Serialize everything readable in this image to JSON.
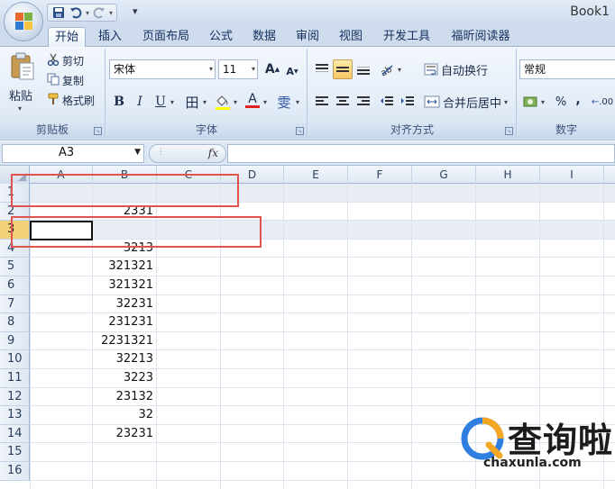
{
  "window": {
    "title": "Book1"
  },
  "quick_access": {
    "icons": [
      "save-icon",
      "undo-icon",
      "redo-icon"
    ],
    "customize_glyph": "▾"
  },
  "tabs": [
    "开始",
    "插入",
    "页面布局",
    "公式",
    "数据",
    "审阅",
    "视图",
    "开发工具",
    "福昕阅读器"
  ],
  "active_tab": "开始",
  "ribbon": {
    "clipboard": {
      "label": "剪贴板",
      "paste": "粘贴",
      "cut": "剪切",
      "copy": "复制",
      "format_painter": "格式刷"
    },
    "font": {
      "label": "字体",
      "name": "宋体",
      "size": "11",
      "grow": "A",
      "shrink": "A",
      "bold": "B",
      "italic": "I",
      "underline": "U",
      "border_glyph": "田",
      "font_color_glyph": "A",
      "phonetic": "雯"
    },
    "alignment": {
      "label": "对齐方式",
      "wrap_text": "自动换行",
      "merge_center": "合并后居中"
    },
    "number": {
      "label": "数字",
      "format": "常规",
      "percent": "%",
      "comma": ",",
      "increase_decimal": ".00"
    }
  },
  "formula_bar": {
    "name_box": "A3",
    "fx": "fx",
    "formula": ""
  },
  "sheet": {
    "columns": [
      "A",
      "B",
      "C",
      "D",
      "E",
      "F",
      "G",
      "H",
      "I"
    ],
    "rows": [
      "1",
      "2",
      "3",
      "4",
      "5",
      "6",
      "7",
      "8",
      "9",
      "10",
      "11",
      "12",
      "13",
      "14",
      "15",
      "16"
    ],
    "selected_row": "3",
    "column_b_values": [
      "",
      "2331",
      "",
      "3213",
      "321321",
      "321321",
      "32231",
      "231231",
      "2231321",
      "32213",
      "3223",
      "23132",
      "32",
      "23231",
      "",
      ""
    ]
  },
  "watermark": {
    "text": "查询啦",
    "url": "chaxunla.com"
  }
}
